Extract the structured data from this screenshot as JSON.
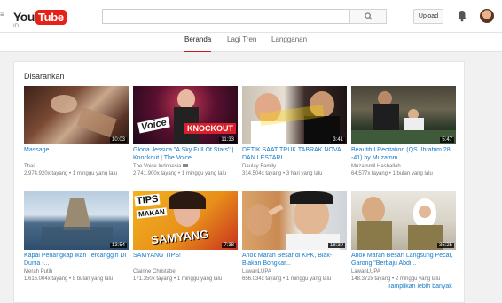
{
  "header": {
    "logo_you": "You",
    "logo_tube": "Tube",
    "country": "ID",
    "upload_label": "Upload"
  },
  "tabs": [
    {
      "label": "Beranda",
      "active": true
    },
    {
      "label": "Lagi Tren",
      "active": false
    },
    {
      "label": "Langganan",
      "active": false
    }
  ],
  "section": {
    "title": "Disarankan",
    "show_more": "Tampilkan lebih banyak"
  },
  "videos": [
    {
      "title": "Massage",
      "channel": "Thai",
      "views": "2.974.920x tayang",
      "age": "1 minggu yang lalu",
      "duration": "10:03",
      "verified": false
    },
    {
      "title": "Gloria Jessica \"A Sky Full Of Stars\" | Knockout | The Voice...",
      "channel": "The Voice Indonesia",
      "views": "2.741.900x tayang",
      "age": "1 minggu yang lalu",
      "duration": "11:33",
      "verified": true
    },
    {
      "title": "DETIK SAAT TRUK TABRAK NOVA DAN LESTARI...",
      "channel": "Daulay Family",
      "views": "314.504x tayang",
      "age": "3 hari yang lalu",
      "duration": "3:41",
      "verified": false
    },
    {
      "title": "Beautiful Recitation (QS. Ibrahim 28 -41) by Muzamm...",
      "channel": "Muzammil Hasballah",
      "views": "64.577x tayang",
      "age": "1 bulan yang lalu",
      "duration": "5:47",
      "verified": false
    },
    {
      "title": "Kapal Penangkap Ikan Tercanggih Di Dunia -...",
      "channel": "Merah Putih",
      "views": "1.616.004x tayang",
      "age": "8 bulan yang lalu",
      "duration": "13:54",
      "verified": false
    },
    {
      "title": "SAMYANG TIPS!",
      "channel": "Clairine Christabel",
      "views": "171.350x tayang",
      "age": "1 minggu yang lalu",
      "duration": "7:38",
      "verified": false
    },
    {
      "title": "Ahok Marah Besar di KPK, Blak-Blakan Bongkar...",
      "channel": "LawanLUPA",
      "views": "656.034x tayang",
      "age": "1 minggu yang lalu",
      "duration": "18:30",
      "verified": false
    },
    {
      "title": "Ahok Marah Besar! Langsung Pecat, Garong \"Berbaju Abdi...",
      "channel": "LawanLUPA",
      "views": "148.372x tayang",
      "age": "2 minggu yang lalu",
      "duration": "35:25",
      "verified": false
    }
  ],
  "thumbs": {
    "texts": {
      "voice": "Voice",
      "knockout": "KNOCKOUT",
      "tips": "TIPS",
      "makan": "MAKAN",
      "samyang": "SAMYANG"
    }
  },
  "colors": {
    "brand_red": "#e62117",
    "link_blue": "#167ac6",
    "tab_active": "#cc181e"
  }
}
